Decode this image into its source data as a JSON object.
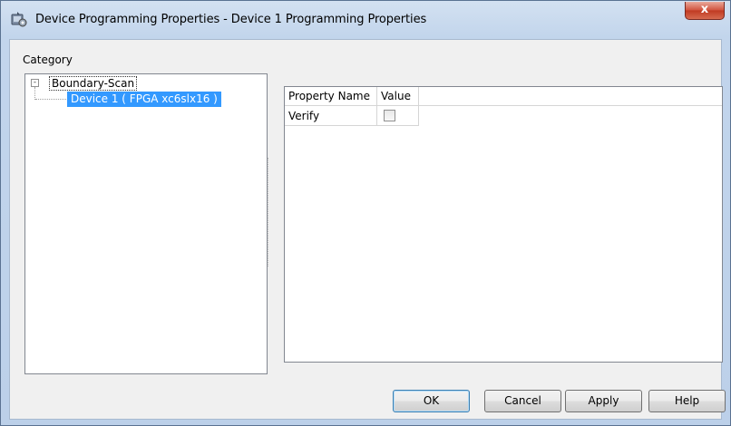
{
  "window": {
    "title": "Device Programming Properties - Device 1 Programming Properties",
    "close_label": "x"
  },
  "category": {
    "label": "Category",
    "tree": {
      "root": "Boundary-Scan",
      "expander": "-",
      "child": "Device 1 ( FPGA xc6slx16 )"
    }
  },
  "properties": {
    "columns": [
      "Property Name",
      "Value"
    ],
    "rows": [
      {
        "name": "Verify",
        "checked": false
      }
    ]
  },
  "buttons": {
    "ok": "OK",
    "cancel": "Cancel",
    "apply": "Apply",
    "help": "Help"
  },
  "colors": {
    "selection": "#3399ff",
    "close_button": "#c8452d"
  }
}
